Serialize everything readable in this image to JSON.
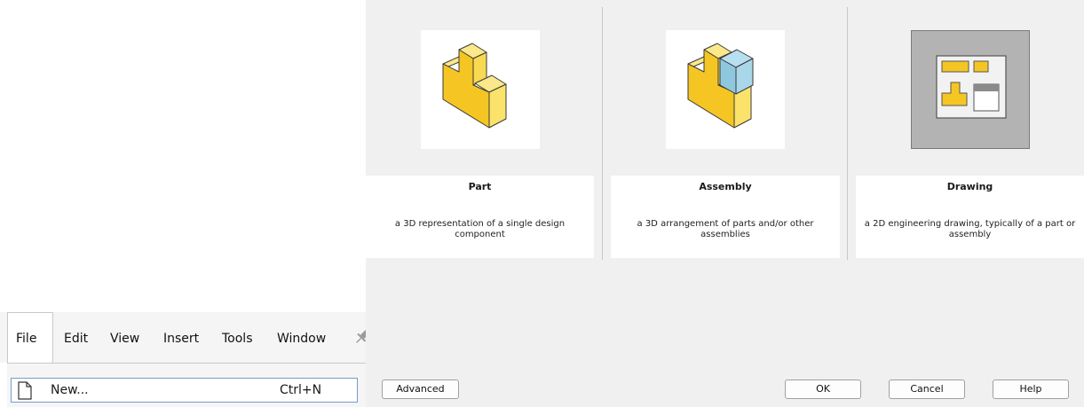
{
  "templates": [
    {
      "title": "Part",
      "description": "a 3D representation of a single design component"
    },
    {
      "title": "Assembly",
      "description": "a 3D arrangement of parts and/or other assemblies"
    },
    {
      "title": "Drawing",
      "description": "a 2D engineering drawing, typically of a part or assembly"
    }
  ],
  "buttons": {
    "advanced": "Advanced",
    "ok": "OK",
    "cancel": "Cancel",
    "help": "Help"
  },
  "menubar": {
    "items": [
      "File",
      "Edit",
      "View",
      "Insert",
      "Tools",
      "Window"
    ],
    "pin_icon": "pin-icon"
  },
  "file_menu": {
    "new_label": "New...",
    "new_shortcut": "Ctrl+N",
    "new_icon": "document-icon"
  },
  "colors": {
    "part_yellow": "#f5c623",
    "assembly_blue": "#8ec8df",
    "drawing_gray": "#b3b3b3",
    "dialog_bg": "#f0f0f0"
  }
}
